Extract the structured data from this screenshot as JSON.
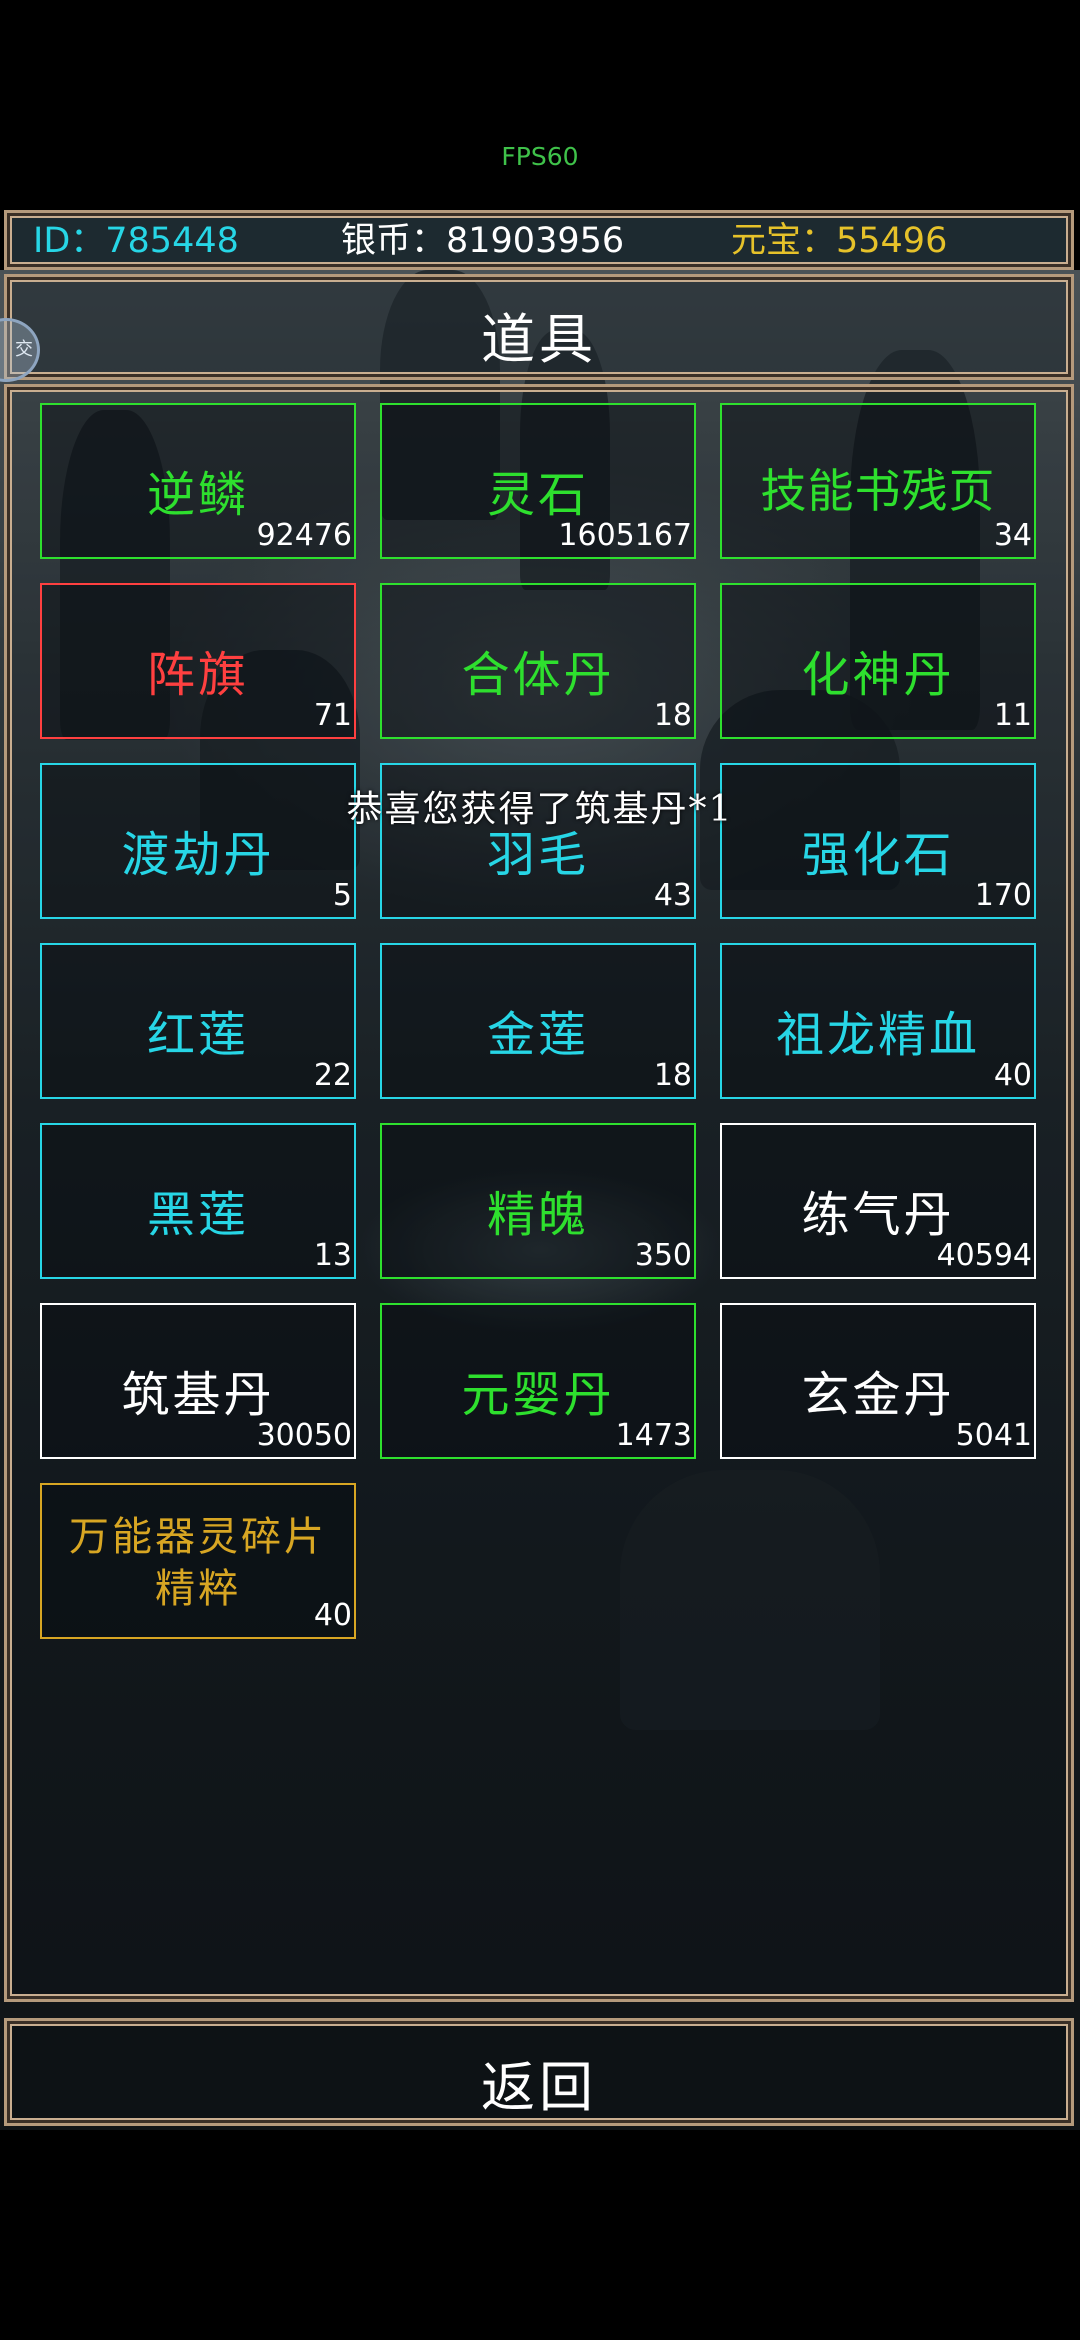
{
  "fps": "FPS60",
  "stats": {
    "id": "ID：785448",
    "silver": "银币：81903956",
    "ingot": "元宝：55496"
  },
  "colors": {
    "green": "#2ee02e",
    "red": "#ff4040",
    "cyan": "#27d6e6",
    "white": "#ffffff",
    "gold": "#d8a623",
    "id_color": "#27d6e6",
    "ingot_color": "#e6c22a",
    "frame": "#b59a7c"
  },
  "title": "道具",
  "side_button": "交",
  "toast": "恭喜您获得了筑基丹*1",
  "back": "返回",
  "items": [
    {
      "name": "逆鳞",
      "count": "92476",
      "color": "green"
    },
    {
      "name": "灵石",
      "count": "1605167",
      "color": "green"
    },
    {
      "name": "技能书残页",
      "count": "34",
      "color": "green"
    },
    {
      "name": "阵旗",
      "count": "71",
      "color": "red"
    },
    {
      "name": "合体丹",
      "count": "18",
      "color": "green"
    },
    {
      "name": "化神丹",
      "count": "11",
      "color": "green"
    },
    {
      "name": "渡劫丹",
      "count": "5",
      "color": "cyan"
    },
    {
      "name": "羽毛",
      "count": "43",
      "color": "cyan"
    },
    {
      "name": "强化石",
      "count": "170",
      "color": "cyan"
    },
    {
      "name": "红莲",
      "count": "22",
      "color": "cyan"
    },
    {
      "name": "金莲",
      "count": "18",
      "color": "cyan"
    },
    {
      "name": "祖龙精血",
      "count": "40",
      "color": "cyan"
    },
    {
      "name": "黑莲",
      "count": "13",
      "color": "cyan"
    },
    {
      "name": "精魄",
      "count": "350",
      "color": "green"
    },
    {
      "name": "练气丹",
      "count": "40594",
      "color": "white"
    },
    {
      "name": "筑基丹",
      "count": "30050",
      "color": "white"
    },
    {
      "name": "元婴丹",
      "count": "1473",
      "color": "green"
    },
    {
      "name": "玄金丹",
      "count": "5041",
      "color": "white"
    },
    {
      "name": "万能器灵碎片精粹",
      "count": "40",
      "color": "gold"
    }
  ]
}
